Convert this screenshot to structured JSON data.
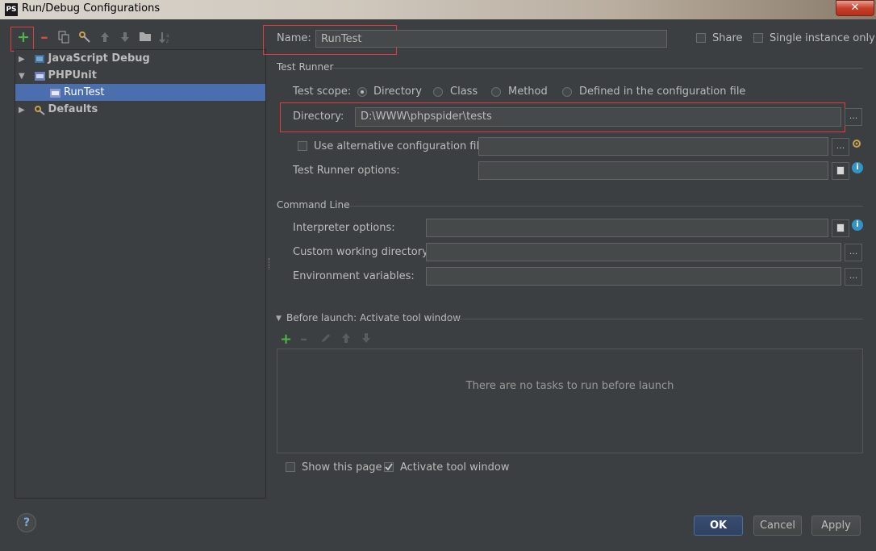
{
  "window": {
    "title": "Run/Debug Configurations",
    "app_badge": "PS",
    "close_glyph": "✕"
  },
  "toolbar": {
    "add_icon": "+",
    "remove_icon": "–",
    "copy_icon": "copy-icon",
    "edit_defaults_icon": "wrench-icon",
    "move_up_icon": "arrow-up-icon",
    "move_down_icon": "arrow-down-icon",
    "folder_icon": "folder-icon",
    "sort_icon": "sort-icon"
  },
  "tree": {
    "items": [
      {
        "label": "JavaScript Debug",
        "expander": "▶"
      },
      {
        "label": "PHPUnit",
        "expander": "▼"
      },
      {
        "label": "RunTest"
      },
      {
        "label": "Defaults",
        "expander": "▶"
      }
    ]
  },
  "name": {
    "label": "Name:",
    "value": "RunTest"
  },
  "share": {
    "label": "Share",
    "checked": false
  },
  "single_instance": {
    "label": "Single instance only",
    "checked": false
  },
  "test_runner": {
    "section_title": "Test Runner",
    "scope_label": "Test scope:",
    "scope_options": [
      {
        "label": "Directory",
        "selected": true
      },
      {
        "label": "Class",
        "selected": false
      },
      {
        "label": "Method",
        "selected": false
      },
      {
        "label": "Defined in the configuration file",
        "selected": false
      }
    ],
    "directory_label": "Directory:",
    "directory_value": "D:\\WWW\\phpspider\\tests",
    "alt_config_label": "Use alternative configuration file:",
    "alt_config_value": "",
    "options_label": "Test Runner options:",
    "options_value": ""
  },
  "command_line": {
    "section_title": "Command Line",
    "interpreter_label": "Interpreter options:",
    "interpreter_value": "",
    "working_dir_label": "Custom working directory:",
    "working_dir_value": "",
    "env_label": "Environment variables:",
    "env_value": ""
  },
  "before_launch": {
    "title": "Before launch: Activate tool window",
    "empty_text": "There are no tasks to run before launch",
    "show_page_label": "Show this page",
    "show_page_checked": false,
    "activate_label": "Activate tool window",
    "activate_checked": true
  },
  "buttons": {
    "ok": "OK",
    "cancel": "Cancel",
    "apply": "Apply",
    "help": "?"
  },
  "ellipsis": "...",
  "info_glyph": "i",
  "colors": {
    "accent_selection": "#4b6eaf",
    "highlight_box": "#e33b3b",
    "add_green": "#4fb448",
    "remove_red": "#d94c3d"
  }
}
